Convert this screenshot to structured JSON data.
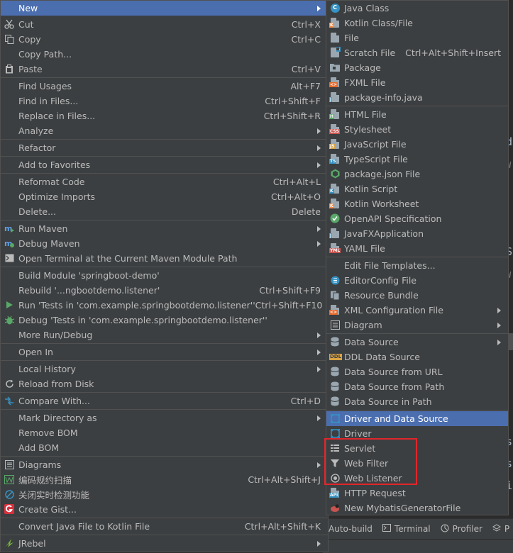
{
  "colors": {
    "menu_bg": "#3c3f41",
    "selected": "#4b6eaf",
    "text": "#bbbbbb",
    "highlight_box": "#e0262b"
  },
  "editor": {
    "marks": [
      "d",
      "W",
      "S",
      "W",
      "s",
      "s",
      "i"
    ]
  },
  "bottombar": {
    "items": [
      {
        "label": "Auto-build",
        "icon": ""
      },
      {
        "label": "Terminal",
        "icon": "terminal-icon"
      },
      {
        "label": "Profiler",
        "icon": "profiler-icon"
      },
      {
        "label": "P",
        "icon": "services-icon"
      }
    ]
  },
  "main_menu": {
    "items": [
      {
        "label": "New",
        "shortcut": "",
        "submenu": true,
        "icon": "",
        "selected": true
      },
      {
        "sep": true
      },
      {
        "label": "Cut",
        "shortcut": "Ctrl+X",
        "icon": "scissors-icon"
      },
      {
        "label": "Copy",
        "shortcut": "Ctrl+C",
        "icon": "copy-icon"
      },
      {
        "label": "Copy Path...",
        "shortcut": ""
      },
      {
        "label": "Paste",
        "shortcut": "Ctrl+V",
        "icon": "paste-icon"
      },
      {
        "sep": true
      },
      {
        "label": "Find Usages",
        "shortcut": "Alt+F7"
      },
      {
        "label": "Find in Files...",
        "shortcut": "Ctrl+Shift+F"
      },
      {
        "label": "Replace in Files...",
        "shortcut": "Ctrl+Shift+R"
      },
      {
        "label": "Analyze",
        "submenu": true
      },
      {
        "sep": true
      },
      {
        "label": "Refactor",
        "submenu": true
      },
      {
        "sep": true
      },
      {
        "label": "Add to Favorites",
        "submenu": true
      },
      {
        "sep": true
      },
      {
        "label": "Reformat Code",
        "shortcut": "Ctrl+Alt+L"
      },
      {
        "label": "Optimize Imports",
        "shortcut": "Ctrl+Alt+O"
      },
      {
        "label": "Delete...",
        "shortcut": "Delete"
      },
      {
        "sep": true
      },
      {
        "label": "Run Maven",
        "submenu": true,
        "icon": "maven-run-icon"
      },
      {
        "label": "Debug Maven",
        "submenu": true,
        "icon": "maven-debug-icon"
      },
      {
        "label": "Open Terminal at the Current Maven Module Path",
        "icon": "terminal-icon"
      },
      {
        "sep": true
      },
      {
        "label": "Build Module 'springboot-demo'"
      },
      {
        "label": "Rebuild '...ngbootdemo.listener'",
        "shortcut": "Ctrl+Shift+F9"
      },
      {
        "label": "Run 'Tests in 'com.example.springbootdemo.listener''",
        "shortcut": "Ctrl+Shift+F10",
        "icon": "run-icon"
      },
      {
        "label": "Debug 'Tests in 'com.example.springbootdemo.listener''",
        "icon": "debug-icon"
      },
      {
        "label": "More Run/Debug",
        "submenu": true
      },
      {
        "sep": true
      },
      {
        "label": "Open In",
        "submenu": true
      },
      {
        "sep": true
      },
      {
        "label": "Local History",
        "submenu": true
      },
      {
        "label": "Reload from Disk",
        "icon": "reload-icon"
      },
      {
        "sep": true
      },
      {
        "label": "Compare With...",
        "shortcut": "Ctrl+D",
        "icon": "compare-icon"
      },
      {
        "sep": true
      },
      {
        "label": "Mark Directory as",
        "submenu": true
      },
      {
        "label": "Remove BOM"
      },
      {
        "label": "Add BOM"
      },
      {
        "sep": true
      },
      {
        "label": "Diagrams",
        "submenu": true,
        "icon": "diagram-icon"
      },
      {
        "label": "编码规约扫描",
        "shortcut": "Ctrl+Alt+Shift+J",
        "icon": "p3c-scan-icon"
      },
      {
        "label": "关闭实时检测功能",
        "icon": "block-icon"
      },
      {
        "label": "Create Gist...",
        "icon": "gist-icon"
      },
      {
        "sep": true
      },
      {
        "label": "Convert Java File to Kotlin File",
        "shortcut": "Ctrl+Alt+Shift+K"
      },
      {
        "sep": true
      },
      {
        "label": "JRebel",
        "submenu": true,
        "icon": "jrebel-icon"
      }
    ]
  },
  "sub_menu": {
    "items": [
      {
        "label": "Java Class",
        "icon": "java-class-icon"
      },
      {
        "label": "Kotlin Class/File",
        "icon": "kotlin-file-icon"
      },
      {
        "label": "File",
        "icon": "file-icon"
      },
      {
        "label": "Scratch File",
        "shortcut": "Ctrl+Alt+Shift+Insert",
        "icon": "scratch-file-icon"
      },
      {
        "label": "Package",
        "icon": "package-icon"
      },
      {
        "label": "FXML File",
        "icon": "fxml-file-icon"
      },
      {
        "label": "package-info.java",
        "icon": "package-info-icon"
      },
      {
        "sep": true
      },
      {
        "label": "HTML File",
        "icon": "html-file-icon"
      },
      {
        "label": "Stylesheet",
        "icon": "css-file-icon"
      },
      {
        "label": "JavaScript File",
        "icon": "js-file-icon"
      },
      {
        "label": "TypeScript File",
        "icon": "ts-file-icon"
      },
      {
        "label": "package.json File",
        "icon": "nodejs-icon"
      },
      {
        "label": "Kotlin Script",
        "icon": "kotlin-script-icon"
      },
      {
        "label": "Kotlin Worksheet",
        "icon": "kotlin-worksheet-icon"
      },
      {
        "label": "OpenAPI Specification",
        "icon": "openapi-icon"
      },
      {
        "label": "JavaFXApplication",
        "icon": "javafx-icon"
      },
      {
        "label": "YAML File",
        "icon": "yaml-file-icon"
      },
      {
        "sep": true
      },
      {
        "label": "Edit File Templates..."
      },
      {
        "label": "EditorConfig File",
        "icon": "editorconfig-icon"
      },
      {
        "label": "Resource Bundle",
        "icon": "resource-bundle-icon"
      },
      {
        "label": "XML Configuration File",
        "submenu": true,
        "icon": "xml-file-icon"
      },
      {
        "label": "Diagram",
        "submenu": true,
        "icon": "diagram-icon"
      },
      {
        "sep": true
      },
      {
        "label": "Data Source",
        "submenu": true,
        "icon": "database-icon"
      },
      {
        "label": "DDL Data Source",
        "icon": "ddl-icon"
      },
      {
        "label": "Data Source from URL",
        "icon": "database-icon"
      },
      {
        "label": "Data Source from Path",
        "icon": "database-icon"
      },
      {
        "label": "Data Source in Path",
        "icon": "database-icon"
      },
      {
        "sep": true
      },
      {
        "label": "Driver and Data Source",
        "icon": "driver-icon",
        "selected": true
      },
      {
        "label": "Driver",
        "icon": "driver-icon"
      },
      {
        "label": "Servlet",
        "icon": "servlet-icon"
      },
      {
        "label": "Web Filter",
        "icon": "filter-icon"
      },
      {
        "label": "Web Listener",
        "icon": "listener-icon"
      },
      {
        "label": "HTTP Request",
        "icon": "http-request-icon"
      },
      {
        "label": "New MybatisGeneratorFile",
        "icon": "mybatis-icon"
      }
    ]
  }
}
